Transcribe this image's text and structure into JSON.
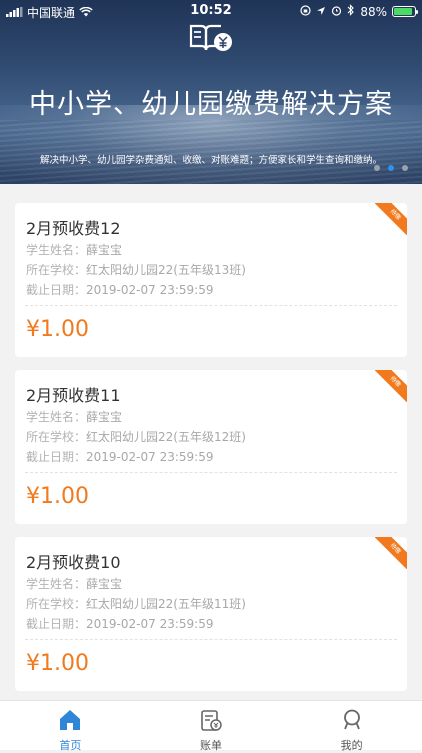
{
  "status_bar": {
    "carrier": "中国联通",
    "time": "10:52",
    "battery": "88%"
  },
  "banner": {
    "title": "中小学、幼儿园缴费解决方案",
    "subtitle": "解决中小学、幼儿园学杂费通知、收缴、对账难题；方便家长和学生查询和缴纳。",
    "active_page": 2,
    "pages": 3
  },
  "labels": {
    "student": "学生姓名：",
    "school": "所在学校：",
    "deadline": "截止日期：",
    "ribbon": "待缴"
  },
  "bills": [
    {
      "title": "2月预收费12",
      "student": "薛宝宝",
      "school": "红太阳幼儿园22(五年级13班)",
      "deadline": "2019-02-07 23:59:59",
      "amount": "¥1.00"
    },
    {
      "title": "2月预收费11",
      "student": "薛宝宝",
      "school": "红太阳幼儿园22(五年级12班)",
      "deadline": "2019-02-07 23:59:59",
      "amount": "¥1.00"
    },
    {
      "title": "2月预收费10",
      "student": "薛宝宝",
      "school": "红太阳幼儿园22(五年级11班)",
      "deadline": "2019-02-07 23:59:59",
      "amount": "¥1.00"
    }
  ],
  "tabbar": {
    "home": "首页",
    "bill": "账单",
    "mine": "我的"
  },
  "colors": {
    "accent": "#f07a1d",
    "tab_active": "#2f86d6",
    "dot_active": "#2b93f0"
  }
}
